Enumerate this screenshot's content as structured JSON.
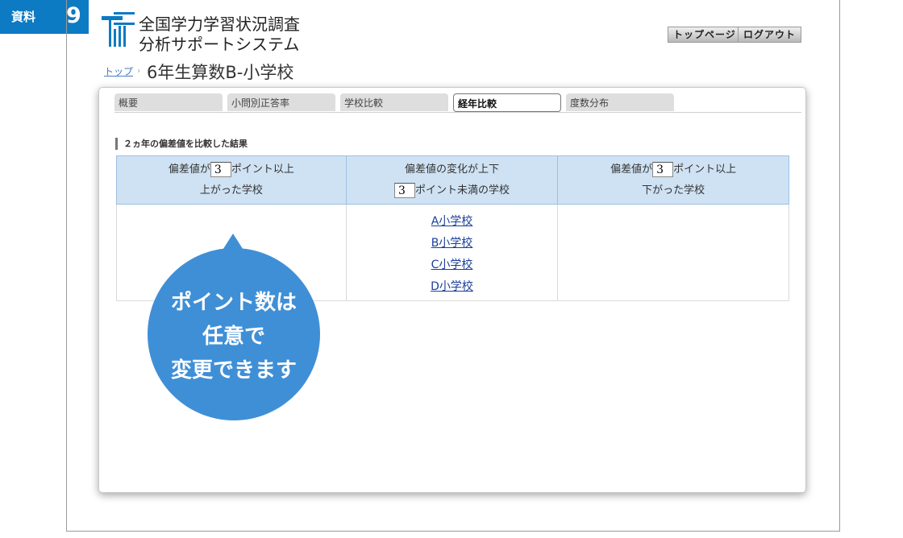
{
  "doc_label": {
    "word": "資料",
    "number": "9"
  },
  "logo": {
    "line1": "全国学力学習状況調査",
    "line2": "分析サポートシステム"
  },
  "header": {
    "top_page_button": "トップページ",
    "logout_button": "ログアウト"
  },
  "breadcrumb": {
    "top_link": "トップ",
    "separator": "›"
  },
  "page_title": "6年生算数B-小学校",
  "tabs": [
    {
      "label": "概要",
      "active": false
    },
    {
      "label": "小問別正答率",
      "active": false
    },
    {
      "label": "学校比較",
      "active": false
    },
    {
      "label": "経年比較",
      "active": true
    },
    {
      "label": "度数分布",
      "active": false
    }
  ],
  "section_title": "２ヵ年の偏差値を比較した結果",
  "table": {
    "col1": {
      "pre": "偏差値が",
      "value": "3",
      "post": "ポイント以上",
      "line2": "上がった学校"
    },
    "col2": {
      "line1": "偏差値の変化が上下",
      "value": "3",
      "post": "ポイント未満の学校"
    },
    "col3": {
      "pre": "偏差値が",
      "value": "3",
      "post": "ポイント以上",
      "line2": "下がった学校"
    },
    "col2_schools": [
      "A小学校",
      "B小学校",
      "C小学校",
      "D小学校"
    ]
  },
  "callout": {
    "line1": "ポイント数は",
    "line2": "任意で",
    "line3": "変更できます"
  },
  "colors": {
    "brand_blue": "#0d7ac4",
    "callout_blue": "#3f8fd6",
    "header_cell": "#cfe2f3"
  }
}
